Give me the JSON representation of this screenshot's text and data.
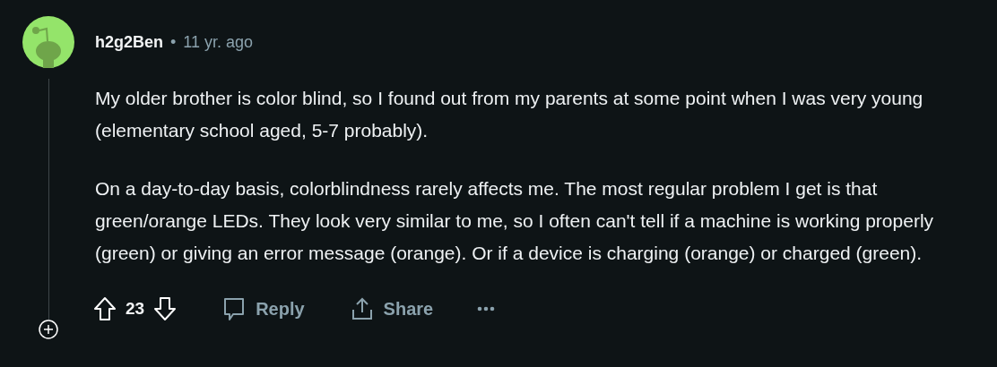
{
  "comment": {
    "author": "h2g2Ben",
    "separator": "•",
    "time": "11 yr. ago",
    "paragraphs": [
      "My older brother is color blind, so I found out from my parents at some point when I was very young (elementary school aged, 5-7 probably).",
      "On a day-to-day basis, colorblindness rarely affects me. The most regular problem I get is that green/orange LEDs. They look very similar to me, so I often can't tell if a machine is working properly (green) or giving an error message (orange). Or if a device is charging (orange) or charged (green)."
    ],
    "score": "23",
    "reply": "Reply",
    "share": "Share"
  }
}
